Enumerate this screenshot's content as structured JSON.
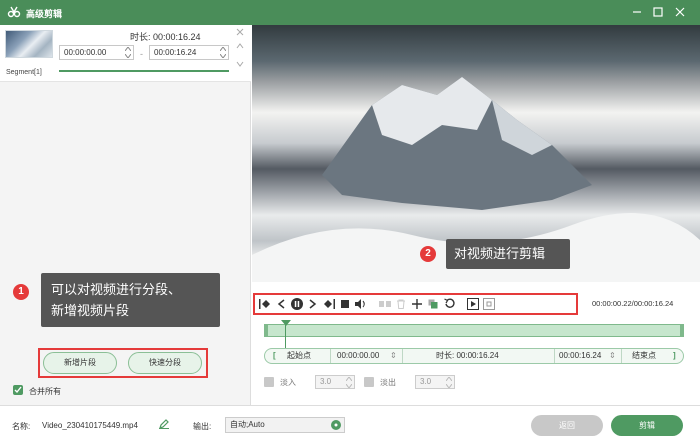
{
  "window": {
    "title": "高级剪辑"
  },
  "segment": {
    "name": "Segment[1]",
    "duration_text": "时长: 00:00:16.24",
    "start_time": "00:00:00.00",
    "end_time": "00:00:16.24",
    "separator": "-"
  },
  "annotations": {
    "badge1": "1",
    "tip1_line1": "可以对视频进行分段、",
    "tip1_line2": "新增视频片段",
    "badge2": "2",
    "tip2": "对视频进行剪辑"
  },
  "left_buttons": {
    "new_segment": "新增片段",
    "quick_split": "快速分段"
  },
  "merge_all": {
    "label": "合并所有",
    "checked": true
  },
  "player": {
    "time_readout": "00:00:00.22/00:00:16.24",
    "playhead_fraction": 0.05
  },
  "range": {
    "start_bracket": "[",
    "start_label": "起始点",
    "start_value": "00:00:00.00",
    "duration_label": "时长: 00:00:16.24",
    "end_value": "00:00:16.24",
    "end_label": "结束点",
    "end_bracket": "]"
  },
  "fade_in": {
    "label": "淡入",
    "value": "3.0"
  },
  "fade_out": {
    "label": "淡出",
    "value": "3.0"
  },
  "footer": {
    "name_label": "名称:",
    "file_name": "Video_230410175449.mp4",
    "output_label": "输出:",
    "output_value": "自动;Auto",
    "return_label": "返回",
    "cut_label": "剪辑"
  },
  "colors": {
    "brand_green": "#4a8d59",
    "accent_green": "#4f9a62",
    "badge_red": "#e53a3a",
    "tooltip_gray": "#555555"
  }
}
